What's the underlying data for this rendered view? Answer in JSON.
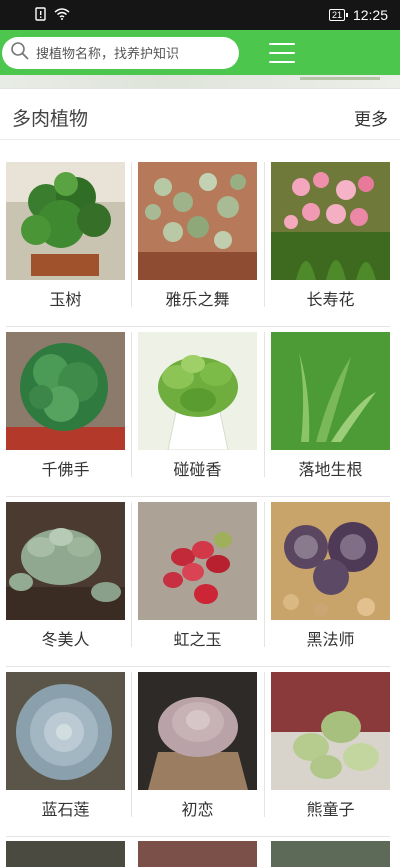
{
  "status_bar": {
    "battery": "21",
    "time": "12:25"
  },
  "search": {
    "placeholder": "搜植物名称，找养护知识"
  },
  "section": {
    "title": "多肉植物",
    "more": "更多"
  },
  "plants": [
    {
      "name": "玉树",
      "icon": "jade-plant"
    },
    {
      "name": "雅乐之舞",
      "icon": "portulacaria-variegata"
    },
    {
      "name": "长寿花",
      "icon": "kalanchoe-flowers"
    },
    {
      "name": "千佛手",
      "icon": "sedum-pachyphyllum"
    },
    {
      "name": "碰碰香",
      "icon": "plectranthus"
    },
    {
      "name": "落地生根",
      "icon": "bryophyllum"
    },
    {
      "name": "冬美人",
      "icon": "graptopetalum-amethystinum"
    },
    {
      "name": "虹之玉",
      "icon": "sedum-rubrotinctum"
    },
    {
      "name": "黑法师",
      "icon": "aeonium-black"
    },
    {
      "name": "蓝石莲",
      "icon": "echeveria-blue"
    },
    {
      "name": "初恋",
      "icon": "echeveria-first-love"
    },
    {
      "name": "熊童子",
      "icon": "cotyledon-bear-paw"
    }
  ],
  "colors": {
    "accent": "#4dc64d",
    "status_bar": "#151515"
  }
}
